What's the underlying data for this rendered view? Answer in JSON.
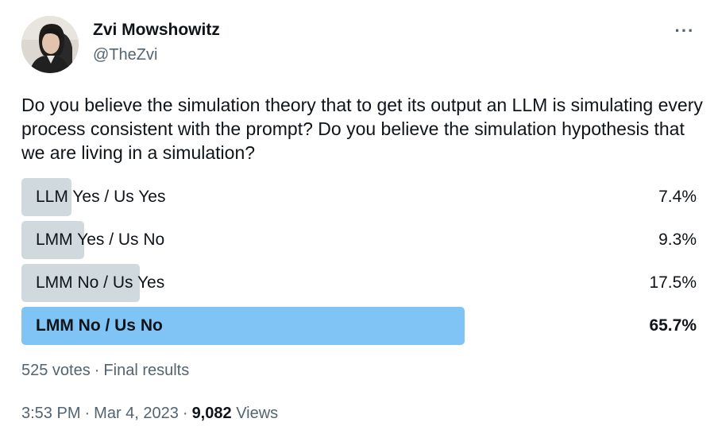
{
  "author": {
    "display_name": "Zvi Mowshowitz",
    "handle": "@TheZvi",
    "avatar_icon": "profile-photo"
  },
  "more_icon": "ellipsis-icon",
  "more_glyph": "···",
  "tweet_text": "Do you believe the simulation theory that to get its output an LLM is simulating every process consistent with the prompt? Do you believe the simulation hypothesis that we are living in a simulation?",
  "poll": {
    "options": [
      {
        "label": "LLM Yes / Us Yes",
        "percent": "7.4%",
        "fraction": 0.074,
        "winner": false
      },
      {
        "label": "LMM Yes / Us No",
        "percent": "9.3%",
        "fraction": 0.093,
        "winner": false
      },
      {
        "label": "LMM No / Us Yes",
        "percent": "17.5%",
        "fraction": 0.175,
        "winner": false
      },
      {
        "label": "LMM No / Us No",
        "percent": "65.7%",
        "fraction": 0.657,
        "winner": true
      }
    ],
    "votes": "525 votes",
    "separator": "·",
    "status": "Final results"
  },
  "meta": {
    "time": "3:53 PM",
    "separator": "·",
    "date": "Mar 4, 2023",
    "views_count": "9,082",
    "views_label": "Views"
  },
  "colors": {
    "bar": "#cfd9de",
    "winner_bar": "#7fc4f5",
    "secondary_text": "#536471",
    "primary_text": "#0f1419"
  }
}
